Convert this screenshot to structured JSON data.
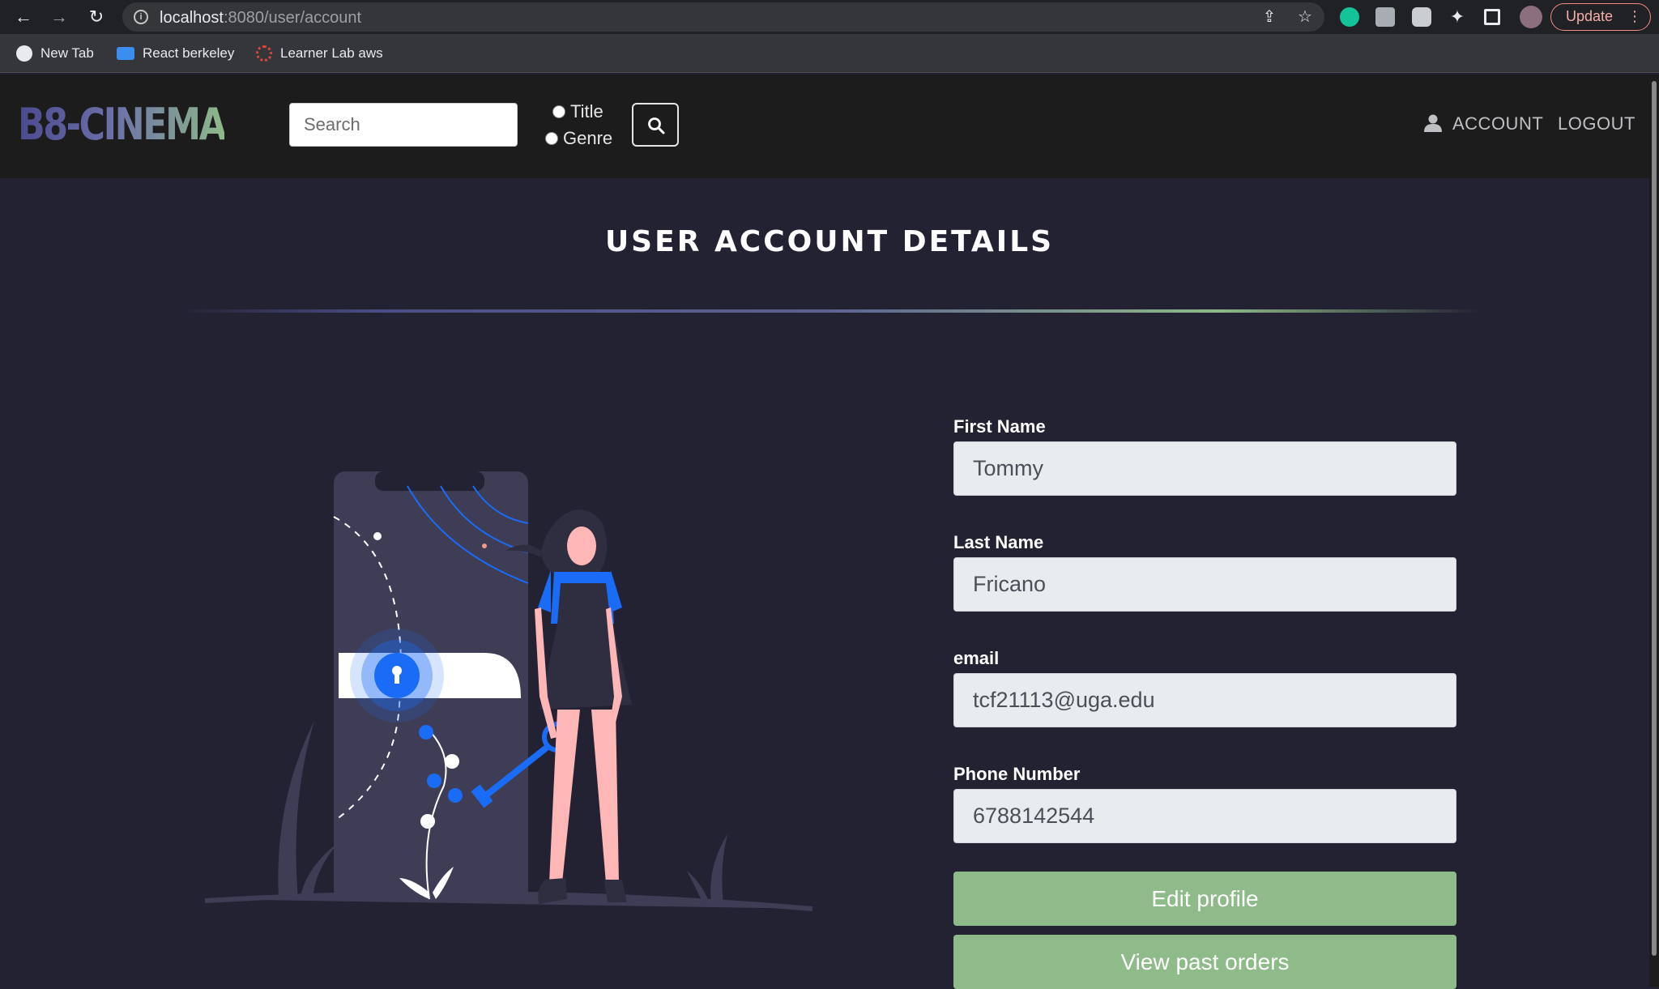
{
  "browser": {
    "url_host": "localhost",
    "url_path": ":8080/user/account",
    "update_label": "Update",
    "bookmarks": [
      {
        "label": "New Tab"
      },
      {
        "label": "React berkeley"
      },
      {
        "label": "Learner Lab aws"
      }
    ]
  },
  "navbar": {
    "logo": "B8-CINEMA",
    "search_placeholder": "Search",
    "radio_title": "Title",
    "radio_genre": "Genre",
    "account_label": "ACCOUNT",
    "logout_label": "LOGOUT"
  },
  "page": {
    "title": "USER ACCOUNT DETAILS"
  },
  "form": {
    "first_name_label": "First Name",
    "first_name_value": "Tommy",
    "last_name_label": "Last Name",
    "last_name_value": "Fricano",
    "email_label": "email",
    "email_value": "tcf21113@uga.edu",
    "phone_label": "Phone Number",
    "phone_value": "6788142544",
    "edit_button": "Edit profile",
    "orders_button": "View past orders"
  },
  "colors": {
    "background": "#232232",
    "navbar": "#1c1c1c",
    "accent_green": "#8fbb8b",
    "accent_blue": "#1a6bf5"
  }
}
